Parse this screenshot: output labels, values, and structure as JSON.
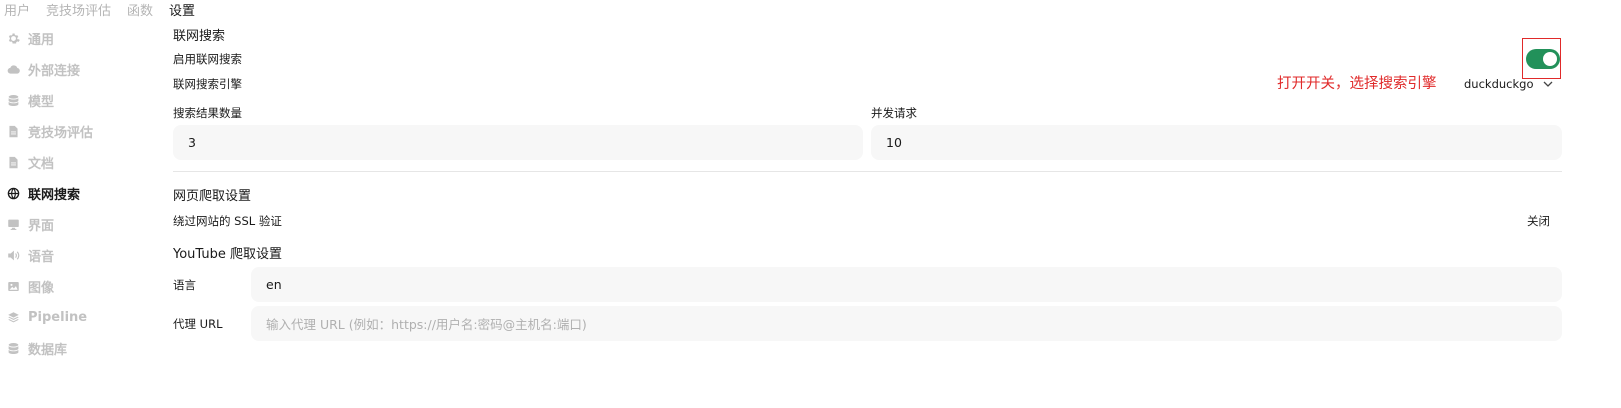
{
  "top_tabs": [
    "用户",
    "竞技场评估",
    "函数",
    "设置"
  ],
  "sidebar": {
    "items": [
      {
        "label": "通用",
        "icon": "gear-icon"
      },
      {
        "label": "外部连接",
        "icon": "cloud-icon"
      },
      {
        "label": "模型",
        "icon": "database-icon"
      },
      {
        "label": "竞技场评估",
        "icon": "document-icon"
      },
      {
        "label": "文档",
        "icon": "document-icon"
      },
      {
        "label": "联网搜索",
        "icon": "globe-icon"
      },
      {
        "label": "界面",
        "icon": "monitor-icon"
      },
      {
        "label": "语音",
        "icon": "speaker-icon"
      },
      {
        "label": "图像",
        "icon": "image-icon"
      },
      {
        "label": "Pipeline",
        "icon": "layers-icon"
      },
      {
        "label": "数据库",
        "icon": "database-icon"
      }
    ],
    "active_index": 5
  },
  "web_search": {
    "section_title": "联网搜索",
    "enable_label": "启用联网搜索",
    "enabled": true,
    "engine_label": "联网搜索引擎",
    "engine_value": "duckduckgo",
    "result_count_label": "搜索结果数量",
    "result_count_value": "3",
    "concurrent_label": "并发请求",
    "concurrent_value": "10"
  },
  "crawl": {
    "section_title": "网页爬取设置",
    "ssl_label": "绕过网站的 SSL 验证",
    "ssl_value": "关闭"
  },
  "youtube": {
    "section_title": "YouTube 爬取设置",
    "language_label": "语言",
    "language_value": "en",
    "proxy_label": "代理 URL",
    "proxy_placeholder": "输入代理 URL (例如：https://用户名:密码@主机名:端口)"
  },
  "annotation": {
    "text": "打开开关，选择搜索引擎",
    "color": "#e02a2a"
  },
  "colors": {
    "toggle_on": "#22915a",
    "input_bg": "#f7f7f7",
    "inactive_text": "#c2c2c2"
  }
}
